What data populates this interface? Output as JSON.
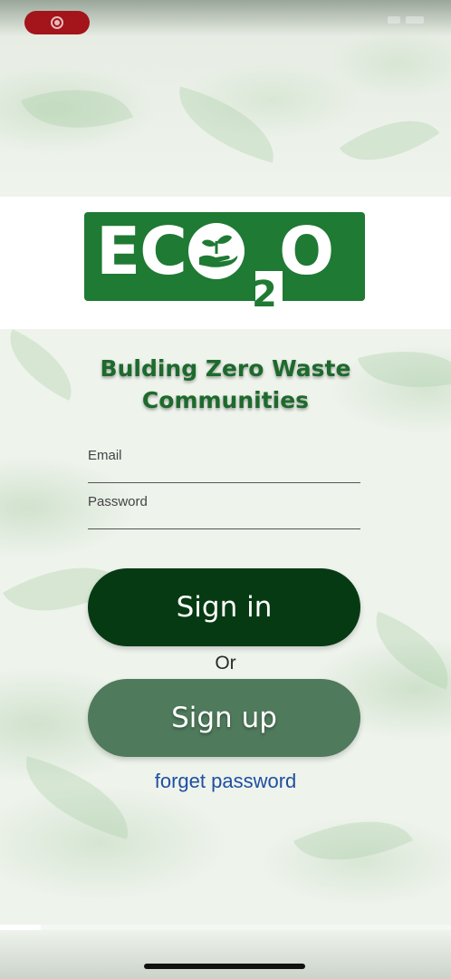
{
  "status_bar": {
    "recording_icon": "screen-record-icon",
    "record_color": "#a3141b"
  },
  "logo": {
    "text_left": "EC",
    "text_sub": "2",
    "text_right": "O",
    "emblem_icon": "hand-with-seedling-icon",
    "brand_color": "#1f7a33"
  },
  "tagline": "Bulding Zero Waste\nCommunities",
  "form": {
    "email_label": "Email",
    "password_label": "Password"
  },
  "buttons": {
    "sign_in": "Sign in",
    "or": "Or",
    "sign_up": "Sign up",
    "forget_password": "forget password"
  },
  "colors": {
    "sign_in_bg": "#063a13",
    "sign_up_bg": "#4f7a5c",
    "link": "#1f4fa0"
  },
  "video_progress": {
    "fraction": 0.09
  }
}
